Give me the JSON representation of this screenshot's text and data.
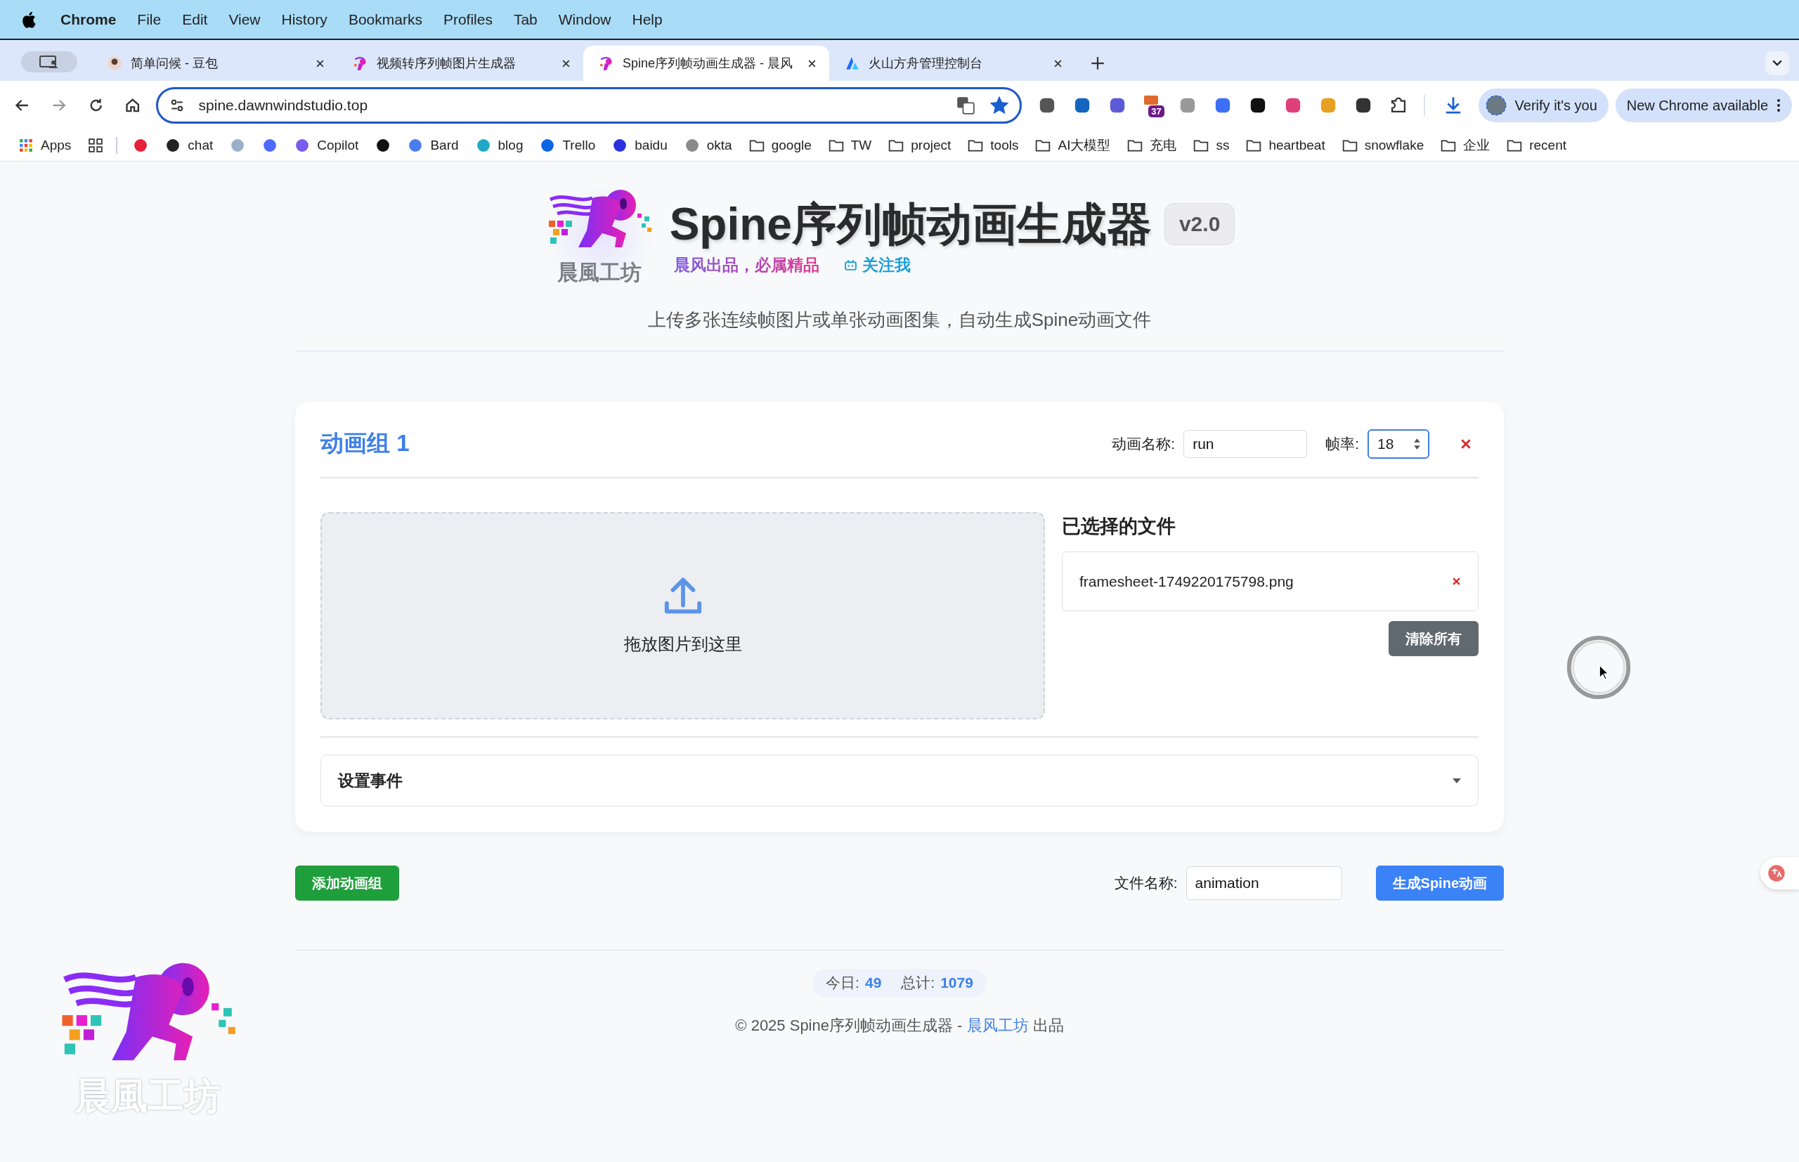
{
  "menu_bar": {
    "app": "Chrome",
    "items": [
      "File",
      "Edit",
      "View",
      "History",
      "Bookmarks",
      "Profiles",
      "Tab",
      "Window",
      "Help"
    ]
  },
  "tabs": [
    {
      "title": "简单问候 - 豆包",
      "kind": "avatar",
      "selected": false
    },
    {
      "title": "视频转序列帧图片生成器",
      "kind": "logo",
      "selected": false
    },
    {
      "title": "Spine序列帧动画生成器 - 晨风",
      "kind": "logo",
      "selected": true
    },
    {
      "title": "火山方舟管理控制台",
      "kind": "volcano",
      "selected": false
    }
  ],
  "address_bar": {
    "url": "spine.dawnwindstudio.top",
    "bookmarked": true
  },
  "toolbar": {
    "extension_badge": "37",
    "verify_button": "Verify it's you",
    "update_button": "New Chrome available"
  },
  "bookmarks": [
    {
      "label": "Apps",
      "kind": "apps"
    },
    {
      "kind": "grid"
    },
    {
      "kind": "site",
      "color": "#e8203a"
    },
    {
      "label": "chat",
      "kind": "site",
      "color": "#222222"
    },
    {
      "kind": "site",
      "color": "#9ab0c8"
    },
    {
      "kind": "site",
      "color": "#4d6bfe"
    },
    {
      "label": "Copilot",
      "kind": "site",
      "color": "#7b5cf0"
    },
    {
      "kind": "site",
      "color": "#111111"
    },
    {
      "label": "Bard",
      "kind": "site",
      "color": "#4a7ef0"
    },
    {
      "label": "blog",
      "kind": "site",
      "color": "#1fa9c6"
    },
    {
      "label": "Trello",
      "kind": "site",
      "color": "#0c66e4"
    },
    {
      "label": "baidu",
      "kind": "site",
      "color": "#2932e1"
    },
    {
      "label": "okta",
      "kind": "site",
      "color": "#8a8a8a"
    },
    {
      "label": "google",
      "kind": "folder"
    },
    {
      "label": "TW",
      "kind": "folder"
    },
    {
      "label": "project",
      "kind": "folder"
    },
    {
      "label": "tools",
      "kind": "folder"
    },
    {
      "label": "AI大模型",
      "kind": "folder"
    },
    {
      "label": "充电",
      "kind": "folder"
    },
    {
      "label": "ss",
      "kind": "folder"
    },
    {
      "label": "heartbeat",
      "kind": "folder"
    },
    {
      "label": "snowflake",
      "kind": "folder"
    },
    {
      "label": "企业",
      "kind": "folder"
    },
    {
      "label": "recent",
      "kind": "folder"
    }
  ],
  "header": {
    "logo_text": "晨風工坊",
    "title": "Spine序列帧动画生成器",
    "version": "v2.0",
    "slogan": "晨风出品，必属精品",
    "follow_link": "关注我",
    "subtitle": "上传多张连续帧图片或单张动画图集，自动生成Spine动画文件"
  },
  "animation_group": {
    "title": "动画组 1",
    "name_label": "动画名称:",
    "name_value": "run",
    "fps_label": "帧率:",
    "fps_value": "18",
    "drop_zone_text": "拖放图片到这里",
    "files_heading": "已选择的文件",
    "files": [
      "framesheet-1749220175798.png"
    ],
    "clear_button": "清除所有",
    "events_header": "设置事件"
  },
  "actions": {
    "add_group_button": "添加动画组",
    "file_name_label": "文件名称:",
    "file_name_value": "animation",
    "generate_button": "生成Spine动画"
  },
  "footer": {
    "today_label": "今日:",
    "today_value": "49",
    "total_label": "总计:",
    "total_value": "1079",
    "copyright": "© 2025 Spine序列帧动画生成器 - ",
    "brand_link": "晨风工坊",
    "suffix": " 出品"
  },
  "corner_logo": {
    "text": "晨風工坊"
  }
}
